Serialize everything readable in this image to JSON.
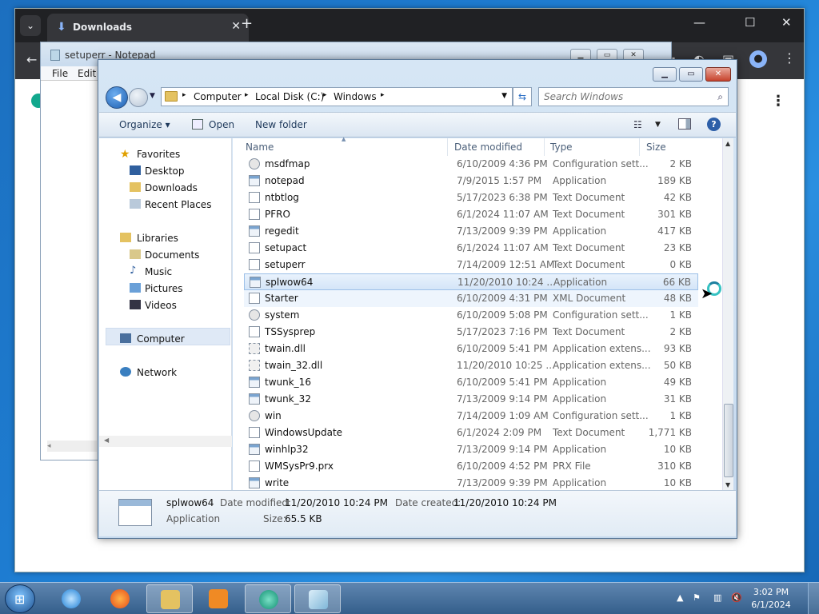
{
  "chrome": {
    "tab_title": "Downloads",
    "tab_close": "✕",
    "new_tab": "+",
    "minimize": "—",
    "maximize": "☐",
    "close": "✕",
    "back": "←",
    "dropdown": "⌄",
    "icons": [
      "download-icon",
      "back-arrow-icon",
      "tab-search-icon",
      "extension-icon",
      "profile-icon",
      "more-menu-icon"
    ]
  },
  "notepad": {
    "title": "setuperr - Notepad",
    "menu": [
      "File",
      "Edit"
    ],
    "buttons": {
      "minimize": "▁",
      "maximize": "▭",
      "close": "✕"
    },
    "hscroll_left": "◂"
  },
  "explorer": {
    "buttons": {
      "minimize": "▁",
      "maximize": "▭",
      "close": "✕"
    },
    "breadcrumb": [
      "Computer",
      "Local Disk (C:)",
      "Windows"
    ],
    "breadcrumb_sep": "▸",
    "search_placeholder": "Search Windows",
    "toolbar": {
      "organize": "Organize ▾",
      "open": "Open",
      "new_folder": "New folder",
      "help": "?"
    },
    "nav": {
      "favorites": "Favorites",
      "favorites_items": [
        "Desktop",
        "Downloads",
        "Recent Places"
      ],
      "libraries": "Libraries",
      "libraries_items": [
        "Documents",
        "Music",
        "Pictures",
        "Videos"
      ],
      "computer": "Computer",
      "network": "Network"
    },
    "columns": [
      "Name",
      "Date modified",
      "Type",
      "Size"
    ],
    "files": [
      {
        "name": "msdfmap",
        "date": "6/10/2009 4:36 PM",
        "type": "Configuration sett...",
        "size": "2 KB",
        "icon": "cfg"
      },
      {
        "name": "notepad",
        "date": "7/9/2015 1:57 PM",
        "type": "Application",
        "size": "189 KB",
        "icon": "app"
      },
      {
        "name": "ntbtlog",
        "date": "5/17/2023 6:38 PM",
        "type": "Text Document",
        "size": "42 KB",
        "icon": "txt"
      },
      {
        "name": "PFRO",
        "date": "6/1/2024 11:07 AM",
        "type": "Text Document",
        "size": "301 KB",
        "icon": "txt"
      },
      {
        "name": "regedit",
        "date": "7/13/2009 9:39 PM",
        "type": "Application",
        "size": "417 KB",
        "icon": "app"
      },
      {
        "name": "setupact",
        "date": "6/1/2024 11:07 AM",
        "type": "Text Document",
        "size": "23 KB",
        "icon": "txt"
      },
      {
        "name": "setuperr",
        "date": "7/14/2009 12:51 AM",
        "type": "Text Document",
        "size": "0 KB",
        "icon": "txt"
      },
      {
        "name": "splwow64",
        "date": "11/20/2010 10:24 ...",
        "type": "Application",
        "size": "66 KB",
        "icon": "app"
      },
      {
        "name": "Starter",
        "date": "6/10/2009 4:31 PM",
        "type": "XML Document",
        "size": "48 KB",
        "icon": "txt"
      },
      {
        "name": "system",
        "date": "6/10/2009 5:08 PM",
        "type": "Configuration sett...",
        "size": "1 KB",
        "icon": "cfg"
      },
      {
        "name": "TSSysprep",
        "date": "5/17/2023 7:16 PM",
        "type": "Text Document",
        "size": "2 KB",
        "icon": "txt"
      },
      {
        "name": "twain.dll",
        "date": "6/10/2009 5:41 PM",
        "type": "Application extens...",
        "size": "93 KB",
        "icon": "dll"
      },
      {
        "name": "twain_32.dll",
        "date": "11/20/2010 10:25 ...",
        "type": "Application extens...",
        "size": "50 KB",
        "icon": "dll"
      },
      {
        "name": "twunk_16",
        "date": "6/10/2009 5:41 PM",
        "type": "Application",
        "size": "49 KB",
        "icon": "app"
      },
      {
        "name": "twunk_32",
        "date": "7/13/2009 9:14 PM",
        "type": "Application",
        "size": "31 KB",
        "icon": "app"
      },
      {
        "name": "win",
        "date": "7/14/2009 1:09 AM",
        "type": "Configuration sett...",
        "size": "1 KB",
        "icon": "cfg"
      },
      {
        "name": "WindowsUpdate",
        "date": "6/1/2024 2:09 PM",
        "type": "Text Document",
        "size": "1,771 KB",
        "icon": "txt"
      },
      {
        "name": "winhlp32",
        "date": "7/13/2009 9:14 PM",
        "type": "Application",
        "size": "10 KB",
        "icon": "app"
      },
      {
        "name": "WMSysPr9.prx",
        "date": "6/10/2009 4:52 PM",
        "type": "PRX File",
        "size": "310 KB",
        "icon": "txt"
      },
      {
        "name": "write",
        "date": "7/13/2009 9:39 PM",
        "type": "Application",
        "size": "10 KB",
        "icon": "app"
      }
    ],
    "selected_index": 7,
    "hover_index": 8,
    "details": {
      "name": "splwow64",
      "type": "Application",
      "modified_label": "Date modified:",
      "modified_value": "11/20/2010 10:24 PM",
      "created_label": "Date created:",
      "created_value": "11/20/2010 10:24 PM",
      "size_label": "Size:",
      "size_value": "65.5 KB"
    }
  },
  "taskbar": {
    "start_glyph": "⊞",
    "apps": [
      "internet-explorer",
      "firefox",
      "windows-explorer",
      "media-player",
      "chrome-app",
      "notepad"
    ],
    "tray": {
      "up": "▲",
      "flag": "⚑",
      "network": "▥",
      "volume": "🔇"
    },
    "time": "3:02 PM",
    "date": "6/1/2024"
  },
  "colors": {
    "selection": "#d4e5f8",
    "taskbar": "#345e8b",
    "chrome_dark": "#202124"
  }
}
